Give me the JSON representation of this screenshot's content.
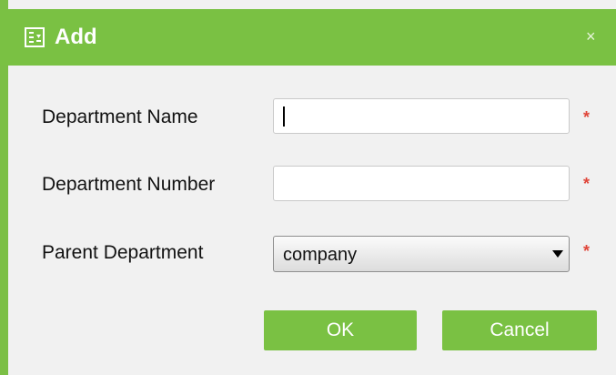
{
  "window": {
    "title": "Add",
    "close_glyph": "×",
    "title_icon": "department-form-icon"
  },
  "form": {
    "fields": [
      {
        "label": "Department Name",
        "value": "",
        "required_mark": "*"
      },
      {
        "label": "Department Number",
        "value": "",
        "required_mark": "*"
      },
      {
        "label": "Parent Department",
        "value": "company",
        "required_mark": "*"
      }
    ]
  },
  "buttons": {
    "ok": "OK",
    "cancel": "Cancel"
  },
  "colors": {
    "accent": "#7ac143",
    "required": "#e0463a"
  }
}
